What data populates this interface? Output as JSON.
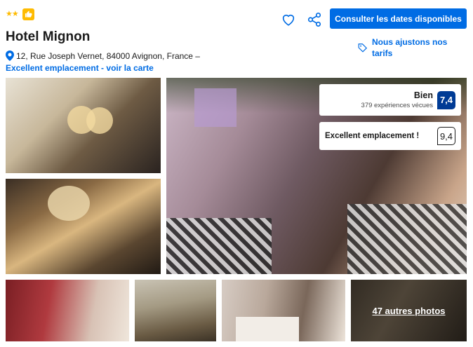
{
  "header": {
    "stars": "★★",
    "hotel_name": "Hotel Mignon",
    "address": "12, Rue Joseph Vernet, 84000 Avignon, France –",
    "location_link": "Excellent emplacement - voir la carte",
    "cta_label": "Consulter les dates disponibles",
    "price_match": "Nous ajustons nos tarifs"
  },
  "review": {
    "word": "Bien",
    "count": "379 expériences vécues",
    "score": "7,4"
  },
  "location_score": {
    "label": "Excellent emplacement !",
    "score": "9,4"
  },
  "gallery": {
    "more_photos": "47 autres photos"
  },
  "colors": {
    "brand_blue": "#006ce4",
    "score_navy": "#003b95",
    "star_yellow": "#febb02"
  },
  "icons": [
    "star-icon",
    "thumbs-up-icon",
    "map-pin-icon",
    "heart-icon",
    "share-icon",
    "tag-icon"
  ]
}
